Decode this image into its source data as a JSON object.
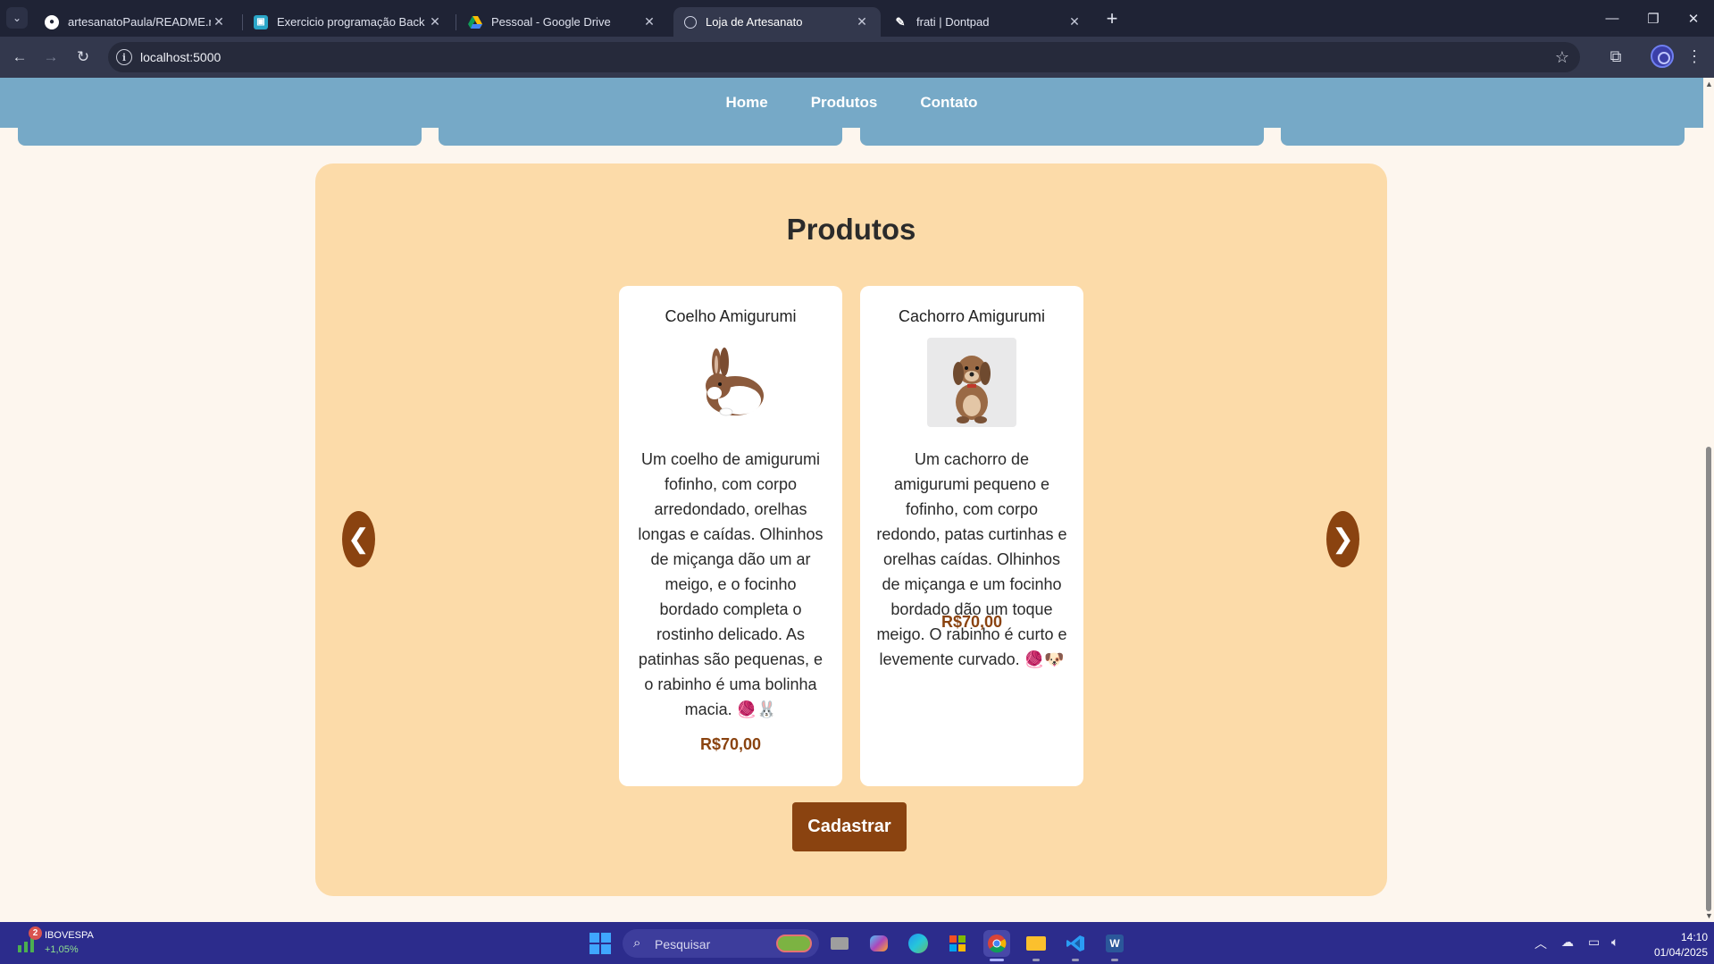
{
  "browser": {
    "tabs": [
      {
        "title": "artesanatoPaula/README.md at",
        "favicon": "github-icon"
      },
      {
        "title": "Exercicio programação Back End",
        "favicon": "classroom-icon"
      },
      {
        "title": "Pessoal - Google Drive",
        "favicon": "google-drive-icon"
      },
      {
        "title": "Loja de Artesanato",
        "favicon": "globe-icon",
        "active": true
      },
      {
        "title": "frati | Dontpad",
        "favicon": "dontpad-icon"
      }
    ],
    "url": "localhost:5000"
  },
  "site": {
    "nav": [
      "Home",
      "Produtos",
      "Contato"
    ],
    "section_title": "Produtos",
    "products": [
      {
        "name": "Coelho Amigurumi",
        "description": "Um coelho de amigurumi fofinho, com corpo arredondado, orelhas longas e caídas. Olhinhos de miçanga dão um ar meigo, e o focinho bordado completa o rostinho delicado. As patinhas são pequenas, e o rabinho é uma bolinha macia. 🧶🐰",
        "price": "R$70,00"
      },
      {
        "name": "Cachorro Amigurumi",
        "description": "Um cachorro de amigurumi pequeno e fofinho, com corpo redondo, patas curtinhas e orelhas caídas. Olhinhos de miçanga e um focinho bordado dão um toque meigo. O rabinho é curto e levemente curvado. 🧶🐶",
        "price": "R$70,00"
      }
    ],
    "prev_arrow": "❮",
    "next_arrow": "❯",
    "register_button": "Cadastrar"
  },
  "taskbar": {
    "widget_badge": "2",
    "widget_name": "IBOVESPA",
    "widget_change": "+1,05%",
    "search_placeholder": "Pesquisar",
    "time": "14:10",
    "date": "01/04/2025"
  },
  "colors": {
    "nav_bg": "#76a9c7",
    "section_bg": "#fcdba9",
    "accent_brown": "#8a4310",
    "page_bg": "#fdf6ee"
  }
}
